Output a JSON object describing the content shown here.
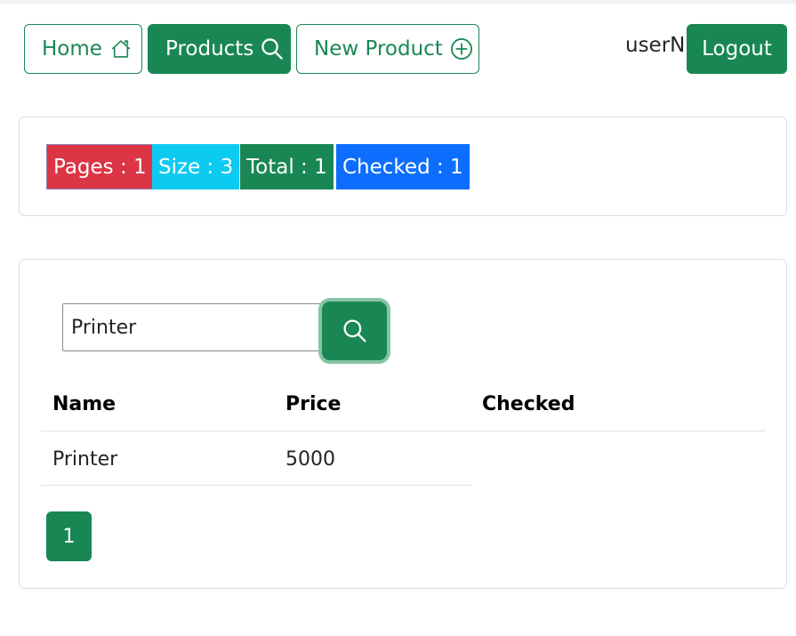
{
  "nav": {
    "home_label": "Home",
    "products_label": "Products",
    "new_product_label": "New Product",
    "home_icon": "house-icon",
    "products_icon": "search-icon",
    "new_product_icon": "plus-circle-icon"
  },
  "user": {
    "name": "userN",
    "logout_label": "Logout"
  },
  "stats": {
    "pages": "Pages : 1",
    "size": "Size : 3",
    "total": "Total : 1",
    "checked": "Checked : 1"
  },
  "search": {
    "value": "Printer"
  },
  "table": {
    "headers": [
      "Name",
      "Price",
      "Checked"
    ],
    "rows": [
      {
        "name": "Printer",
        "price": "5000",
        "checked": ""
      }
    ]
  },
  "pagination": {
    "pages": [
      "1"
    ]
  },
  "colors": {
    "success": "#198754",
    "danger": "#dc3545",
    "info": "#0dcaf0",
    "primary": "#0d6efd"
  }
}
